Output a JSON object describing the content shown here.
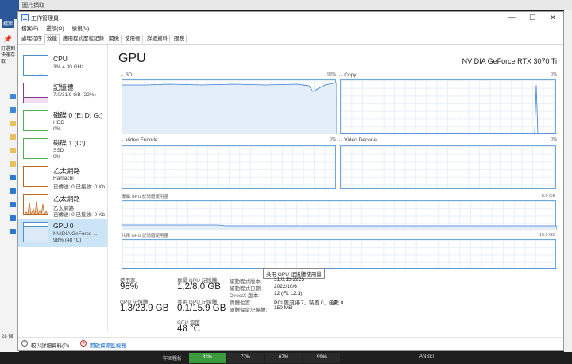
{
  "window": {
    "title": "工作管理員",
    "controls": {
      "minimize": "—",
      "maximize": "☐",
      "close": "✕"
    }
  },
  "menu": [
    "檔案(F)",
    "選項(O)",
    "檢視(V)"
  ],
  "tabs": [
    "處理程序",
    "效能",
    "應用程式歷程記錄",
    "開機",
    "使用者",
    "詳細資料",
    "服務"
  ],
  "active_tab": "效能",
  "sidebar": {
    "items": [
      {
        "name": "CPU",
        "lines": [
          "3% 4.30 GHz"
        ]
      },
      {
        "name": "記憶體",
        "lines": [
          "7.0/31.9 GB (22%)"
        ]
      },
      {
        "name": "磁碟 0 (E: D: G:)",
        "lines": [
          "HDD",
          "0%"
        ]
      },
      {
        "name": "磁碟 1 (C:)",
        "lines": [
          "SSD",
          "0%"
        ]
      },
      {
        "name": "乙太網路",
        "lines": [
          "Hamachi",
          "已傳送: 0 已接收: 0 Kb"
        ]
      },
      {
        "name": "乙太網路",
        "lines": [
          "乙太網路",
          "已傳送: 0 已接收: 0 Kb"
        ]
      },
      {
        "name": "GPU 0",
        "lines": [
          "NVIDIA GeForce ...",
          "98% (48 °C)"
        ]
      }
    ]
  },
  "main": {
    "title": "GPU",
    "model": "NVIDIA GeForce RTX 3070 Ti",
    "engines": [
      {
        "name": "3D",
        "value": "98%"
      },
      {
        "name": "Copy",
        "value": "0%"
      },
      {
        "name": "Video Encode",
        "value": "0%"
      },
      {
        "name": "Video Decode",
        "value": "0%"
      }
    ],
    "dedicated_label": "專屬 GPU 記憶體使用量",
    "dedicated_max": "8.0 GB",
    "shared_label": "共用 GPU 記憶體使用量",
    "shared_max": "15.9 GB",
    "tooltip": "共用 GPU 記憶體使用量",
    "stats": {
      "utilization_label": "使用率",
      "utilization": "98%",
      "dedicated_mem_label": "專屬 GPU 記憶體",
      "dedicated_mem": "1.2/8.0 GB",
      "gpu_mem_label": "GPU 記憶體",
      "gpu_mem": "1.3/23.9 GB",
      "shared_mem_label": "共用 GPU 記憶體",
      "shared_mem": "0.1/15.9 GB",
      "temp_label": "GPU 溫度",
      "temp": "48 °C"
    },
    "details": [
      {
        "k": "驅動程式版本:",
        "v": "31.0.15.2225"
      },
      {
        "k": "驅動程式日期:",
        "v": "2022/10/6"
      },
      {
        "k": "DirectX 版本:",
        "v": "12 (FL 12.1)"
      },
      {
        "k": "實體位置:",
        "v": "PCI 匯流排 7，裝置 0，函數 0"
      },
      {
        "k": "硬體保留記憶體:",
        "v": "150 MB"
      }
    ]
  },
  "footer": {
    "fewer_details": "較少詳細資料(D)",
    "open_monitor": "開啟資源監視器"
  },
  "background": {
    "left_tab": "檔案",
    "left_pin_text": "釘選到快速存取",
    "left_footer": "28 個",
    "top_text": "圖片擷取",
    "taskbar_label": "牢固粗析",
    "taskbar_chips": [
      "83%",
      "77%",
      "67%",
      "59%"
    ],
    "taskbar_right": "ANSEI"
  },
  "colors": {
    "accent": "#4a90d0",
    "memory": "#8b3a8b",
    "disk": "#4caf50",
    "network": "#c0641e",
    "taskbar_green": "#3c9a3c"
  }
}
